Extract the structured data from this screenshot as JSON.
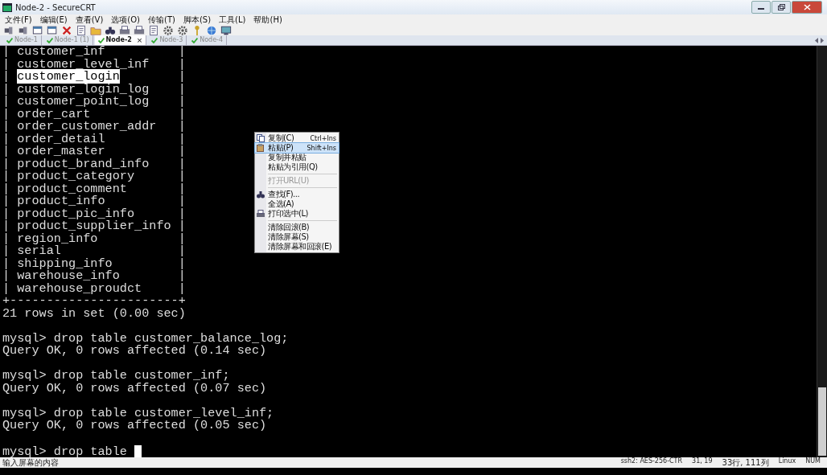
{
  "window": {
    "title": "Node-2 - SecureCRT"
  },
  "menu": [
    "文件(F)",
    "编辑(E)",
    "查看(V)",
    "选项(O)",
    "传输(T)",
    "脚本(S)",
    "工具(L)",
    "帮助(H)"
  ],
  "tabs": [
    {
      "label": "Node-1",
      "selected": false
    },
    {
      "label": "Node-1 (1)",
      "selected": false
    },
    {
      "label": "Node-2",
      "selected": true
    },
    {
      "label": "Node-3",
      "selected": false
    },
    {
      "label": "Node-4",
      "selected": false
    }
  ],
  "close_glyph": "×",
  "terminal": {
    "lines": [
      {
        "text": "| customer_inf          |"
      },
      {
        "text": "| customer_level_inf    |"
      },
      {
        "segments": [
          {
            "text": "| ",
            "selected": false
          },
          {
            "text": "customer_login",
            "selected": true
          },
          {
            "text": "        |",
            "selected": false
          }
        ]
      },
      {
        "text": "| customer_login_log    |"
      },
      {
        "text": "| customer_point_log    |"
      },
      {
        "text": "| order_cart            |"
      },
      {
        "text": "| order_customer_addr   |"
      },
      {
        "text": "| order_detail          |"
      },
      {
        "text": "| order_master          |"
      },
      {
        "text": "| product_brand_info    |"
      },
      {
        "text": "| product_category      |"
      },
      {
        "text": "| product_comment       |"
      },
      {
        "text": "| product_info          |"
      },
      {
        "text": "| product_pic_info      |"
      },
      {
        "text": "| product_supplier_info |"
      },
      {
        "text": "| region_info           |"
      },
      {
        "text": "| serial                |"
      },
      {
        "text": "| shipping_info         |"
      },
      {
        "text": "| warehouse_info        |"
      },
      {
        "text": "| warehouse_proudct     |"
      },
      {
        "text": "+-----------------------+"
      },
      {
        "text": "21 rows in set (0.00 sec)"
      },
      {
        "text": "mysql> drop table customer_balance_log;",
        "blank_line_before": true
      },
      {
        "text": "Query OK, 0 rows affected (0.14 sec)"
      },
      {
        "text": "mysql> drop table customer_inf;",
        "blank_line_before": true
      },
      {
        "text": "Query OK, 0 rows affected (0.07 sec)"
      },
      {
        "text": "mysql> drop table customer_level_inf;",
        "blank_line_before": true
      },
      {
        "text": "Query OK, 0 rows affected (0.05 sec)"
      },
      {
        "text": "mysql> drop table ",
        "cursor": true,
        "blank_line_before": true
      }
    ]
  },
  "context_menu": [
    {
      "kind": "item",
      "label": "复制(C)",
      "shortcut": "Ctrl+Ins",
      "selected": false,
      "disabled": false
    },
    {
      "kind": "item",
      "label": "粘贴(P)",
      "shortcut": "Shift+Ins",
      "selected": true,
      "disabled": false
    },
    {
      "kind": "item",
      "label": "复制并粘贴",
      "selected": false,
      "disabled": false
    },
    {
      "kind": "item",
      "label": "粘贴为引用(Q)",
      "selected": false,
      "disabled": false
    },
    {
      "kind": "separator"
    },
    {
      "kind": "item",
      "label": "打开URL(U)",
      "selected": false,
      "disabled": true
    },
    {
      "kind": "separator"
    },
    {
      "kind": "item",
      "label": "查找(F)...",
      "selected": false,
      "disabled": false
    },
    {
      "kind": "item",
      "label": "全选(A)",
      "selected": false,
      "disabled": false
    },
    {
      "kind": "item",
      "label": "打印选中(L)",
      "selected": false,
      "disabled": false
    },
    {
      "kind": "separator"
    },
    {
      "kind": "item",
      "label": "清除回滚(B)",
      "selected": false,
      "disabled": false
    },
    {
      "kind": "item",
      "label": "清除屏幕(S)",
      "selected": false,
      "disabled": false
    },
    {
      "kind": "item",
      "label": "清除屏幕和回滚(E)",
      "selected": false,
      "disabled": false
    }
  ],
  "status_bar": {
    "message": "输入屏幕的内容",
    "cipher": "ssh2: AES-256-CTR",
    "position": "31, 19",
    "size": "33行, 111列",
    "os": "Linux",
    "keys": "NUM"
  }
}
